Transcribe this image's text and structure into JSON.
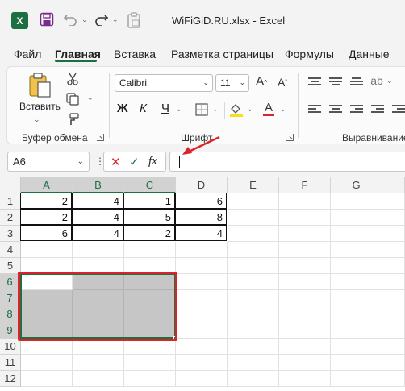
{
  "app": {
    "title": "WiFiGiD.RU.xlsx  -  Excel",
    "logo_letter": "X"
  },
  "tabs": [
    "Файл",
    "Главная",
    "Вставка",
    "Разметка страницы",
    "Формулы",
    "Данные"
  ],
  "active_tab": "Главная",
  "ribbon": {
    "clipboard": {
      "paste_label": "Вставить",
      "group_label": "Буфер обмена"
    },
    "font": {
      "font_name": "Calibri",
      "font_size": "11",
      "bold": "Ж",
      "italic": "К",
      "underline": "Ч",
      "grow": "A",
      "shrink": "A",
      "color_letter": "A",
      "group_label": "Шрифт",
      "font_color": "#d9252a"
    },
    "alignment": {
      "group_label": "Выравнивание"
    }
  },
  "formula_bar": {
    "name_box": "A6",
    "fx": "fx",
    "cancel": "✕",
    "enter": "✓",
    "formula": ""
  },
  "grid": {
    "columns": [
      "A",
      "B",
      "C",
      "D",
      "E",
      "F",
      "G"
    ],
    "rows": [
      "1",
      "2",
      "3",
      "4",
      "5",
      "6",
      "7",
      "8",
      "9",
      "10",
      "11",
      "12"
    ],
    "cells": [
      [
        "2",
        "4",
        "1",
        "6"
      ],
      [
        "2",
        "4",
        "5",
        "8"
      ],
      [
        "6",
        "4",
        "2",
        "4"
      ]
    ],
    "selected_range": "A6:C9"
  },
  "colors": {
    "accent": "#1d6f42",
    "highlight": "#d9252a"
  }
}
